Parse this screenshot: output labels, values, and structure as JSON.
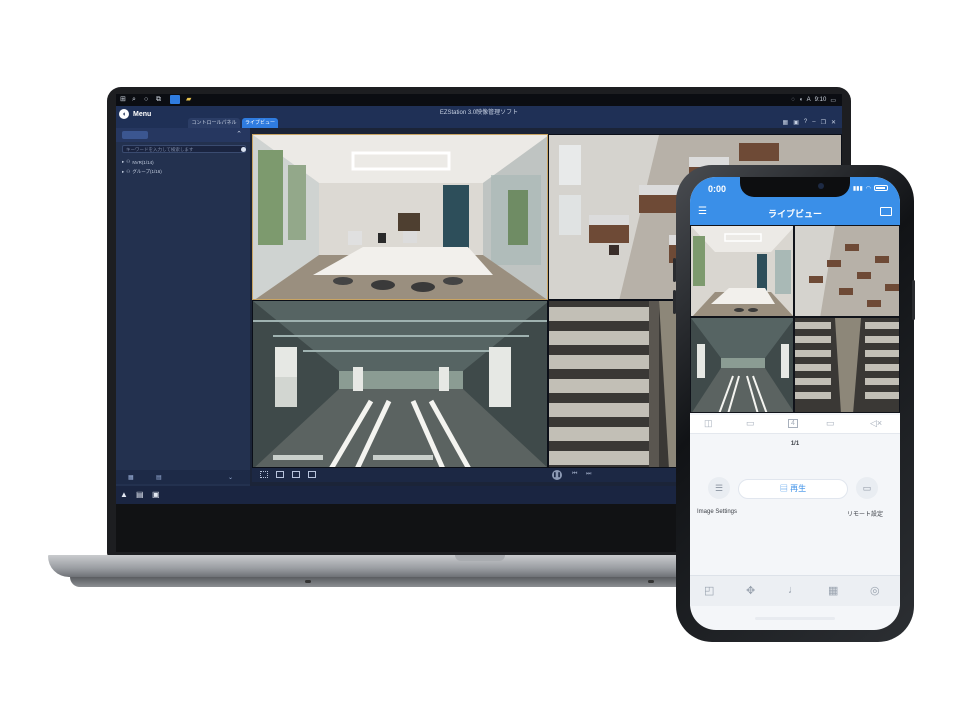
{
  "laptop": {
    "window_title": "EZStation 3.0映像管理ソフト",
    "menu_label": "Menu",
    "tabs": [
      {
        "label": "コントロールパネル"
      },
      {
        "label": "ライブビュー"
      }
    ],
    "tray_time": "9:10",
    "search_placeholder": "キーワードを入力して検索します",
    "tree": [
      {
        "label": "NVR(1/14)"
      },
      {
        "label": "グループ(1/16)"
      }
    ],
    "icons": {
      "start": "windows-icon",
      "search": "search-icon",
      "circle": "cortana-icon",
      "task_view": "task-view-icon",
      "app": "ezstation-icon",
      "folder": "folder-icon"
    }
  },
  "phone": {
    "time": "0:00",
    "title": "ライブビュー",
    "pager": "1/1",
    "tool_split_count": "4",
    "play_label": "再生",
    "image_settings_label": "Image Settings",
    "remote_settings_label": "リモート設定"
  },
  "colors": {
    "accent": "#3a8fe8",
    "app_header": "#1f3056",
    "panel": "#23314f",
    "selection": "#c9a462"
  }
}
